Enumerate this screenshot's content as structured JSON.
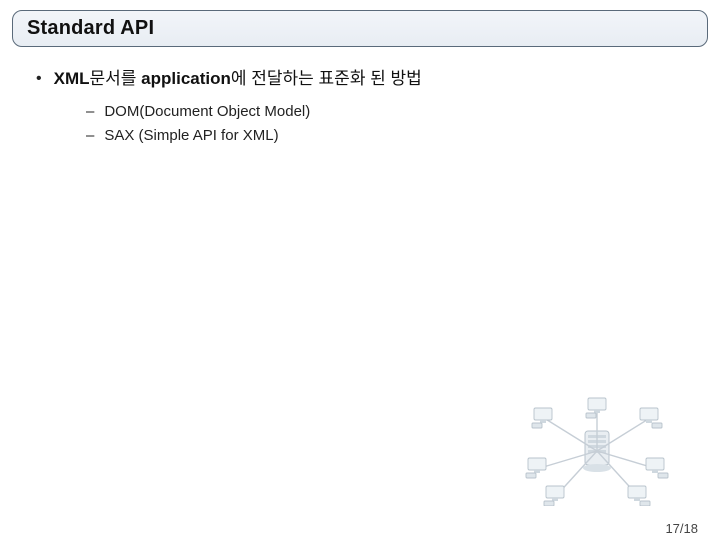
{
  "title": "Standard API",
  "main_bullet": {
    "prefix": "XML",
    "mid1": "문서를 ",
    "bold2": "application",
    "suffix": "에 전달하는 표준화 된 방법"
  },
  "sub_items": [
    "DOM(Document Object Model)",
    "SAX (Simple API for XML)"
  ],
  "page": "17/18"
}
